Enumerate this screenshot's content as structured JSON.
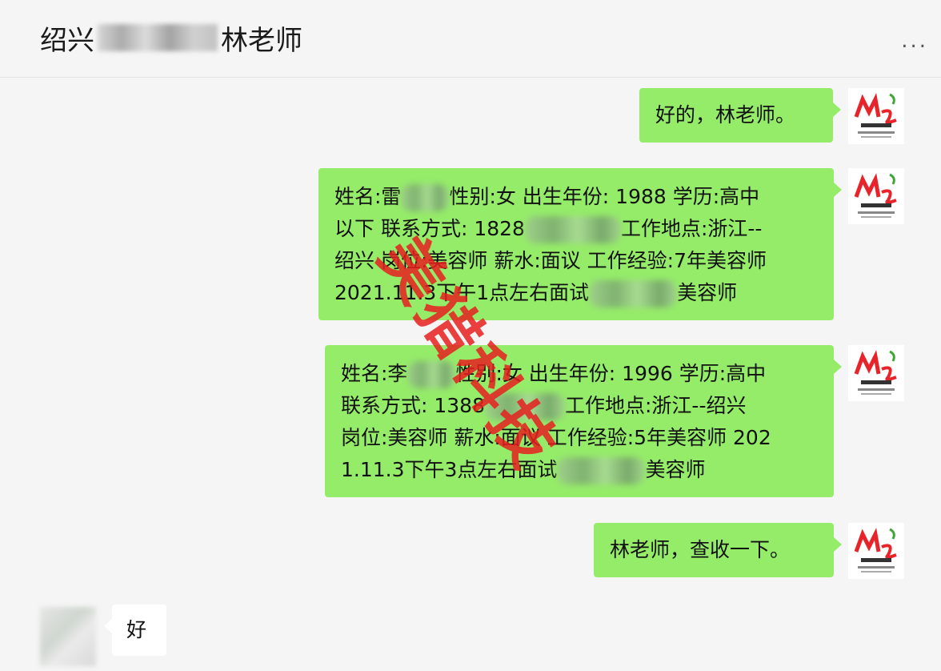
{
  "header": {
    "title_prefix": "绍兴",
    "title_suffix": "林老师",
    "more_label": "..."
  },
  "messages": [
    {
      "side": "right",
      "text": "好的，林老师。"
    },
    {
      "side": "right",
      "lines": [
        "姓名:雷",
        "性别:女 出生年份: 1988 学历:高中",
        "以下 联系方式: 1828",
        "工作地点:浙江--",
        "绍兴 岗位:美容师 薪水:面议 工作经验:7年美容师",
        "2021.11.3下午1点左右面试",
        "美容师"
      ]
    },
    {
      "side": "right",
      "lines": [
        "姓名:李",
        "性别:女 出生年份: 1996 学历:高中",
        "联系方式: 1388",
        "工作地点:浙江--绍兴",
        "岗位:美容师 薪水:面议 工作经验:5年美容师 202",
        "1.11.3下午3点左右面试",
        "美容师"
      ]
    },
    {
      "side": "right",
      "text": "林老师，查收一下。"
    },
    {
      "side": "left",
      "text": "好"
    }
  ],
  "watermark": "美猎科技",
  "avatar_logo": {
    "caption": "美猎客服3",
    "url_text": "www.meilieaoreng.com",
    "accent": "#e8242b",
    "accent2": "#3fa535"
  },
  "colors": {
    "bubble_self": "#95ec69",
    "bubble_peer": "#ffffff",
    "background": "#f5f5f5"
  }
}
